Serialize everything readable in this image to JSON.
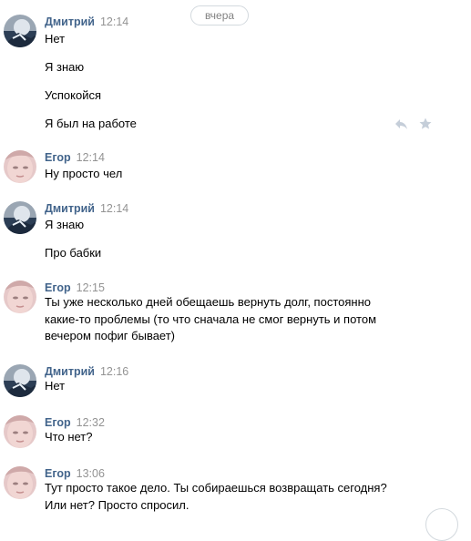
{
  "date_divider": "вчера",
  "messages": [
    {
      "author": "Дмитрий",
      "time": "12:14",
      "avatar": "avatar-dmitry",
      "lines": [
        "Нет",
        "Я знаю",
        "Успокойся",
        "Я был на работе"
      ]
    },
    {
      "author": "Егор",
      "time": "12:14",
      "avatar": "avatar-egor",
      "lines": [
        "Ну просто чел"
      ]
    },
    {
      "author": "Дмитрий",
      "time": "12:14",
      "avatar": "avatar-dmitry",
      "lines": [
        "Я знаю",
        "Про бабки"
      ]
    },
    {
      "author": "Егор",
      "time": "12:15",
      "avatar": "avatar-egor",
      "lines": [
        "Ты уже несколько дней обещаешь вернуть долг, постоянно",
        "какие-то проблемы (то что сначала не смог вернуть и потом",
        "вечером пофиг бывает)"
      ]
    },
    {
      "author": "Дмитрий",
      "time": "12:16",
      "avatar": "avatar-dmitry",
      "lines": [
        "Нет"
      ]
    },
    {
      "author": "Егор",
      "time": "12:32",
      "avatar": "avatar-egor",
      "lines": [
        "Что нет?"
      ]
    },
    {
      "author": "Егор",
      "time": "13:06",
      "avatar": "avatar-egor",
      "lines": [
        "Тут просто такое дело. Ты собираешься возвращать сегодня?",
        "Или нет? Просто спросил."
      ]
    }
  ],
  "hover_actions": {
    "reply_icon": "reply-icon",
    "star_icon": "star-icon"
  },
  "colors": {
    "author": "#42648b",
    "time": "#939393",
    "icons": "#c5ced9"
  }
}
